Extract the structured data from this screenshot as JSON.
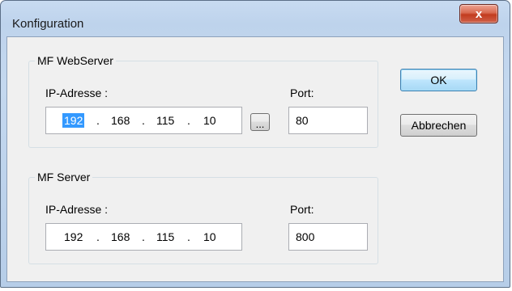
{
  "window": {
    "title": "Konfiguration",
    "close_glyph": "x"
  },
  "webserver": {
    "group_label": "MF WebServer",
    "ip_label": "IP-Adresse :",
    "ip": [
      "192",
      "168",
      "115",
      "10"
    ],
    "ip_separator": ".",
    "port_label": "Port:",
    "port": "80",
    "browse_label": "..."
  },
  "server": {
    "group_label": "MF Server",
    "ip_label": "IP-Adresse :",
    "ip": [
      "192",
      "168",
      "115",
      "10"
    ],
    "ip_separator": ".",
    "port_label": "Port:",
    "port": "800"
  },
  "buttons": {
    "ok": "OK",
    "cancel": "Abbrechen"
  },
  "colors": {
    "selection": "#3399ff",
    "client_background": "#f0f0f0",
    "close_button": "#c23c1e"
  },
  "icons": {
    "close": "close-icon"
  }
}
